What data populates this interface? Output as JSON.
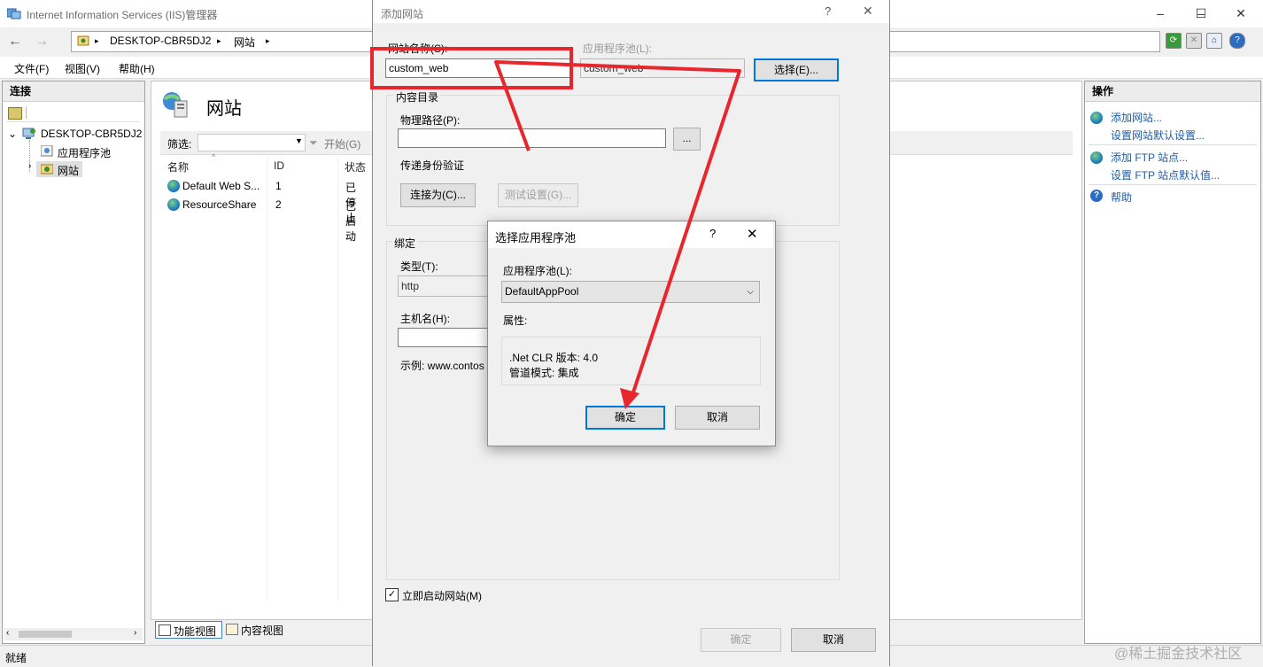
{
  "window": {
    "title": "Internet Information Services (IIS)管理器",
    "minimize": "–",
    "maximize": "☐",
    "close": "✕"
  },
  "nav": {
    "back": "←",
    "forward": "→",
    "breadcrumb": [
      "DESKTOP-CBR5DJ2",
      "网站"
    ],
    "sep": "▸",
    "help_icon": "?"
  },
  "menu": [
    "文件(F)",
    "视图(V)",
    "帮助(H)"
  ],
  "connections": {
    "header": "连接",
    "tree": {
      "root": "DESKTOP-CBR5DJ2",
      "children": [
        "应用程序池",
        "网站"
      ]
    }
  },
  "sites": {
    "title": "网站",
    "filter_label": "筛选:",
    "start_label": "开始(G)",
    "columns": [
      "名称",
      "ID",
      "状态"
    ],
    "rows": [
      {
        "name": "Default Web S...",
        "id": "1",
        "status": "已停止"
      },
      {
        "name": "ResourceShare",
        "id": "2",
        "status": "已启动"
      }
    ],
    "feature_view": "功能视图",
    "content_view": "内容视图"
  },
  "actions": {
    "header": "操作",
    "links": [
      "添加网站...",
      "设置网站默认设置...",
      "添加 FTP 站点...",
      "设置 FTP 站点默认值...",
      "帮助"
    ]
  },
  "status": {
    "text": "就绪"
  },
  "add_site": {
    "title": "添加网站",
    "help": "?",
    "close": "✕",
    "site_name_label": "网站名称(S):",
    "site_name_value": "custom_web",
    "app_pool_label": "应用程序池(L):",
    "app_pool_value": "custom_web",
    "select_button": "选择(E)...",
    "content_dir_label": "内容目录",
    "physical_path_label": "物理路径(P):",
    "physical_path_value": "",
    "browse_button": "...",
    "pass_auth_label": "传递身份验证",
    "connect_as_button": "连接为(C)...",
    "test_settings_button": "测试设置(G)...",
    "binding_label": "绑定",
    "type_label": "类型(T):",
    "type_value": "http",
    "host_label": "主机名(H):",
    "host_value": "",
    "example_text": "示例: www.contos",
    "start_immediately_label": "立即启动网站(M)",
    "start_immediately_checked": true,
    "ok_button": "确定",
    "cancel_button": "取消"
  },
  "select_pool": {
    "title": "选择应用程序池",
    "help": "?",
    "close": "✕",
    "pool_label": "应用程序池(L):",
    "pool_value": "DefaultAppPool",
    "properties_label": "属性:",
    "clr_version": ".Net CLR 版本: 4.0",
    "pipeline_mode": "管道模式: 集成",
    "ok_button": "确定",
    "cancel_button": "取消"
  },
  "watermark": "@稀土掘金技术社区",
  "colors": {
    "annotation_red": "#e8262e",
    "focus_blue": "#0078d7",
    "link_blue": "#1e5ca8"
  }
}
